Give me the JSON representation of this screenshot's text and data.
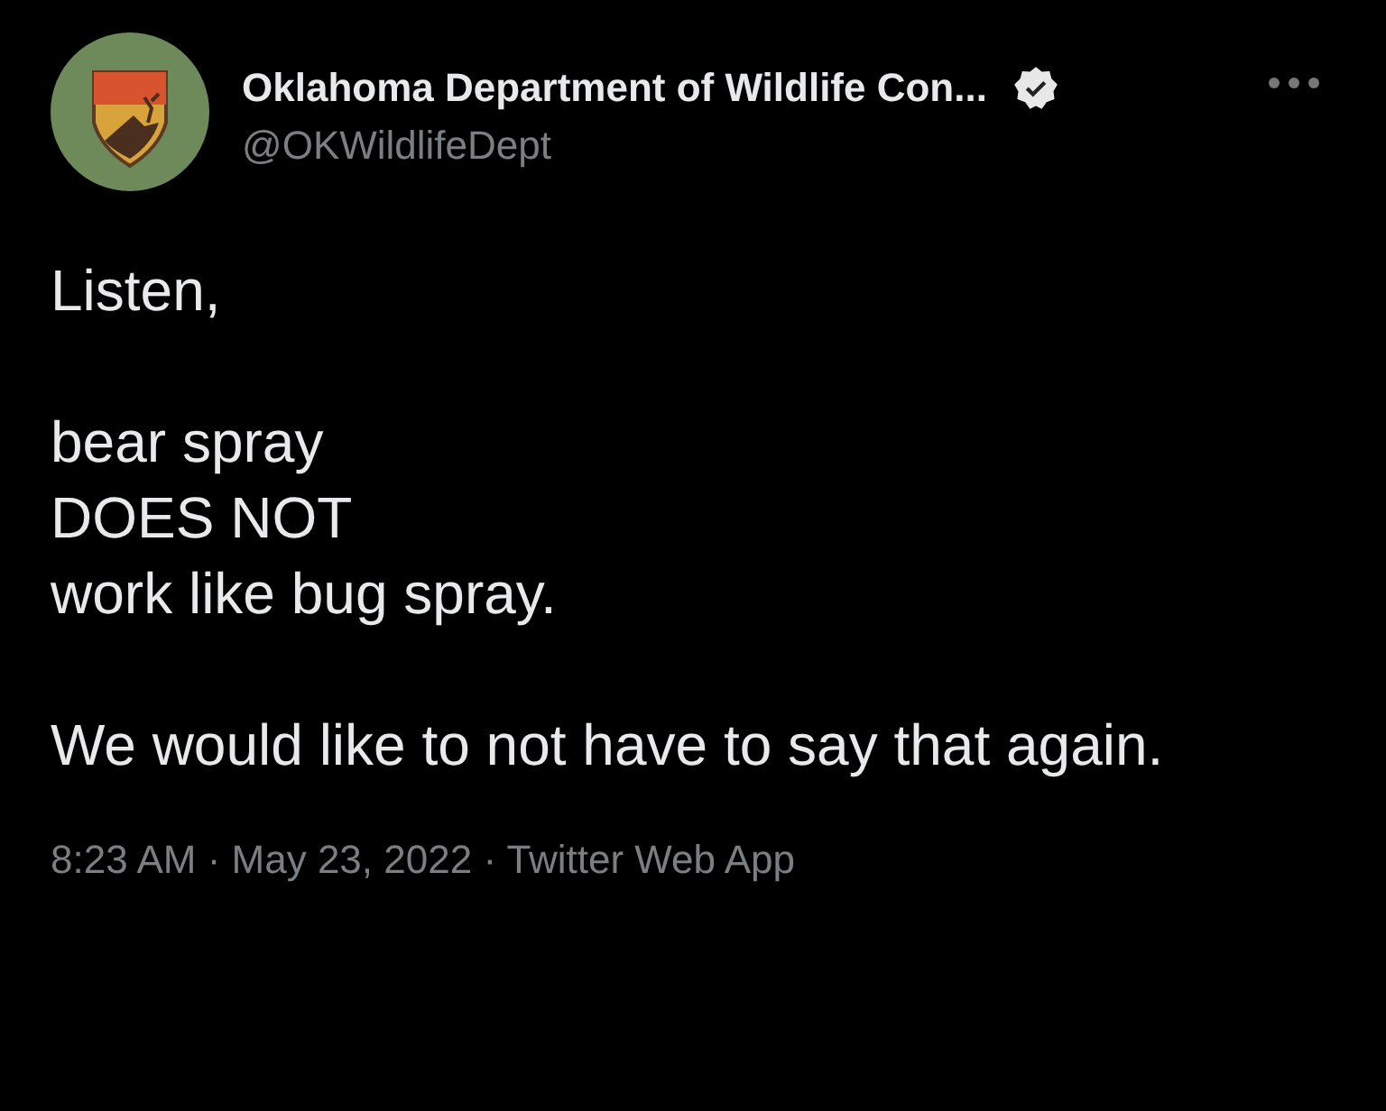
{
  "author": {
    "name": "Oklahoma Department of Wildlife Con...",
    "handle": "@OKWildlifeDept"
  },
  "tweet": {
    "paragraphs": [
      "Listen,",
      "bear spray\nDOES NOT\nwork like bug spray.",
      "We would like to not have to say that again."
    ],
    "meta": "8:23 AM · May 23, 2022 · Twitter Web App"
  }
}
